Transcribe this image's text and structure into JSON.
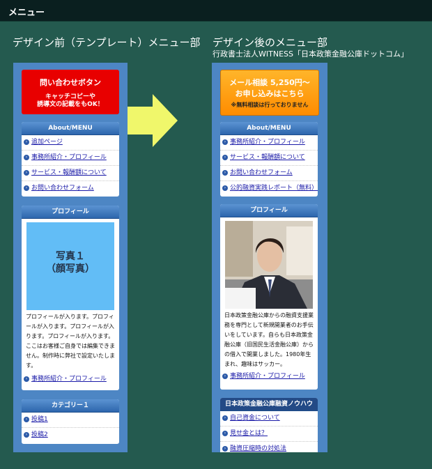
{
  "header": {
    "title": "メニュー"
  },
  "left": {
    "title": "デザイン前（テンプレート）メニュー部",
    "cta": {
      "line1": "問い合わせボタン",
      "line2": "キャッチコピーや",
      "line3": "誘導文の記載をもOK！"
    },
    "about": {
      "heading": "About/MENU",
      "items": [
        "追加ページ",
        "事務所紹介・プロフィール",
        "サービス・報酬額について",
        "お問い合わせフォーム"
      ]
    },
    "profile": {
      "heading": "プロフィール",
      "photo_line1": "写真１",
      "photo_line2": "（顔写真）",
      "text": "プロフィールが入ります。プロフィールが入ります。プロフィールが入ります。プロフィールが入ります。ここはお客様ご自身では編集できません。制作時に弊社で設定いたします。",
      "link": "事務所紹介・プロフィール"
    },
    "category": {
      "heading": "カテゴリー１",
      "items": [
        "投稿1",
        "投稿2"
      ]
    }
  },
  "right": {
    "title": "デザイン後のメニュー部",
    "subtitle": "行政書士法人WITNESS「日本政策金融公庫ドットコム」",
    "cta": {
      "line1": "メール相談 5,250円～",
      "line2": "お申し込みはこちら",
      "line3": "※無料相談は行っておりません"
    },
    "about": {
      "heading": "About/MENU",
      "items": [
        "事務所紹介・プロフィール",
        "サービス・報酬額について",
        "お問い合わせフォーム",
        "公的融資実践レポート（無料）"
      ]
    },
    "profile": {
      "heading": "プロフィール",
      "text": "日本政策金融公庫からの融資支援業務を専門として新規開業者のお手伝いをしています。自らも日本政策金融公庫（旧国民生活金融公庫）からの借入で開業しました。1980年生まれ、趣味はサッカー。",
      "link": "事務所紹介・プロフィール"
    },
    "knowhow": {
      "heading": "日本政策金融公庫融資ノウハウ",
      "items": [
        "自己資金について",
        "見せ金とは？",
        "融資圧縮時の対処法"
      ]
    }
  },
  "colors": {
    "background": "#245a4f",
    "column": "#4d86c4",
    "cta_red": "#e80000",
    "cta_orange": "#ff9f14",
    "arrow": "#f0f76b"
  }
}
